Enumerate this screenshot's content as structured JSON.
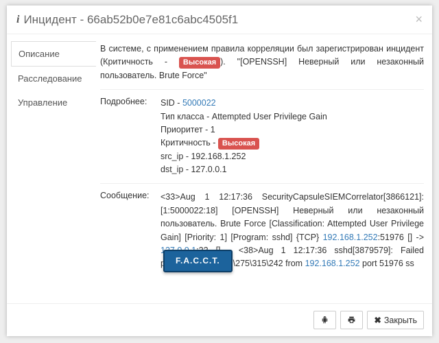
{
  "header": {
    "title": "Инцидент - 66ab52b0e7e81c6abc4505f1"
  },
  "tabs": [
    {
      "label": "Описание",
      "active": true
    },
    {
      "label": "Расследование",
      "active": false
    },
    {
      "label": "Управление",
      "active": false
    }
  ],
  "description": {
    "prefix": "В системе, с применением правила корреляции был зарегистрирован инцидент (Критичность - ",
    "severity": "Высокая",
    "suffix": "). \"[OPENSSH] Неверный или незаконный пользователь. Brute Force\""
  },
  "details": {
    "label": "Подробнее:",
    "sid_label": "SID - ",
    "sid_value": "5000022",
    "class_type": "Тип класса - Attempted User Privilege Gain",
    "priority": "Приоритет - 1",
    "severity_label": "Критичность - ",
    "severity_value": "Высокая",
    "src_ip": "src_ip - 192.168.1.252",
    "dst_ip": "dst_ip - 127.0.0.1"
  },
  "message": {
    "label": "Сообщение:",
    "t1": "<33>Aug 1 12:17:36 SecurityCapsuleSIEMCorrelator[3866121]: [1:5000022:18] [OPENSSH] Неверный или незаконный пользователь. Brute Force [Classification: Attempted User Privilege Gain] [Priority: 1] [Program: sshd] {TCP} ",
    "ip1": "192.168.1.252",
    "t2": ":51976 [] -> ",
    "ip2": "127.0.0.1",
    "t3": ":22 [] - <38>Aug 1 12:17:36 sshd[3879579]: Failed password fo",
    "hidden": "87\\277\\275\\315\\242",
    "t4": " from ",
    "ip3": "192.168.1.252",
    "t5": " port 51976 ss"
  },
  "overlay": {
    "facct": "F.A.C.C.T."
  },
  "footer": {
    "close": "Закрыть"
  }
}
